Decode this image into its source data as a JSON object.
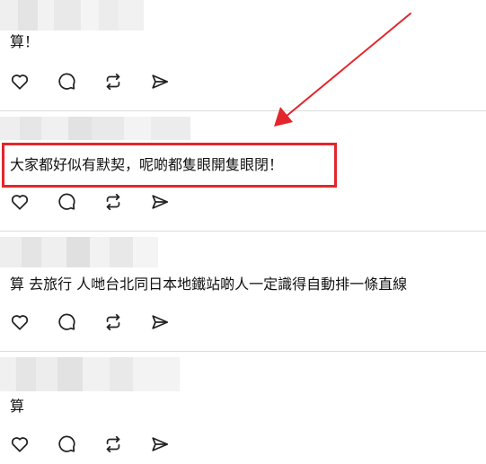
{
  "posts": [
    {
      "text": "算！"
    },
    {
      "text": "大家都好似有默契，呢啲都隻眼開隻眼閉！"
    },
    {
      "text": "算 去旅行 人哋台北同日本地鐵站啲人一定識得自動排一條直線"
    },
    {
      "text": "算"
    }
  ],
  "action_icons": [
    "heart-icon",
    "comment-icon",
    "repost-icon",
    "share-icon"
  ],
  "colors": {
    "annotation_red": "#e3262c",
    "icon_stroke": "#222222",
    "divider": "#dcdcdc"
  }
}
